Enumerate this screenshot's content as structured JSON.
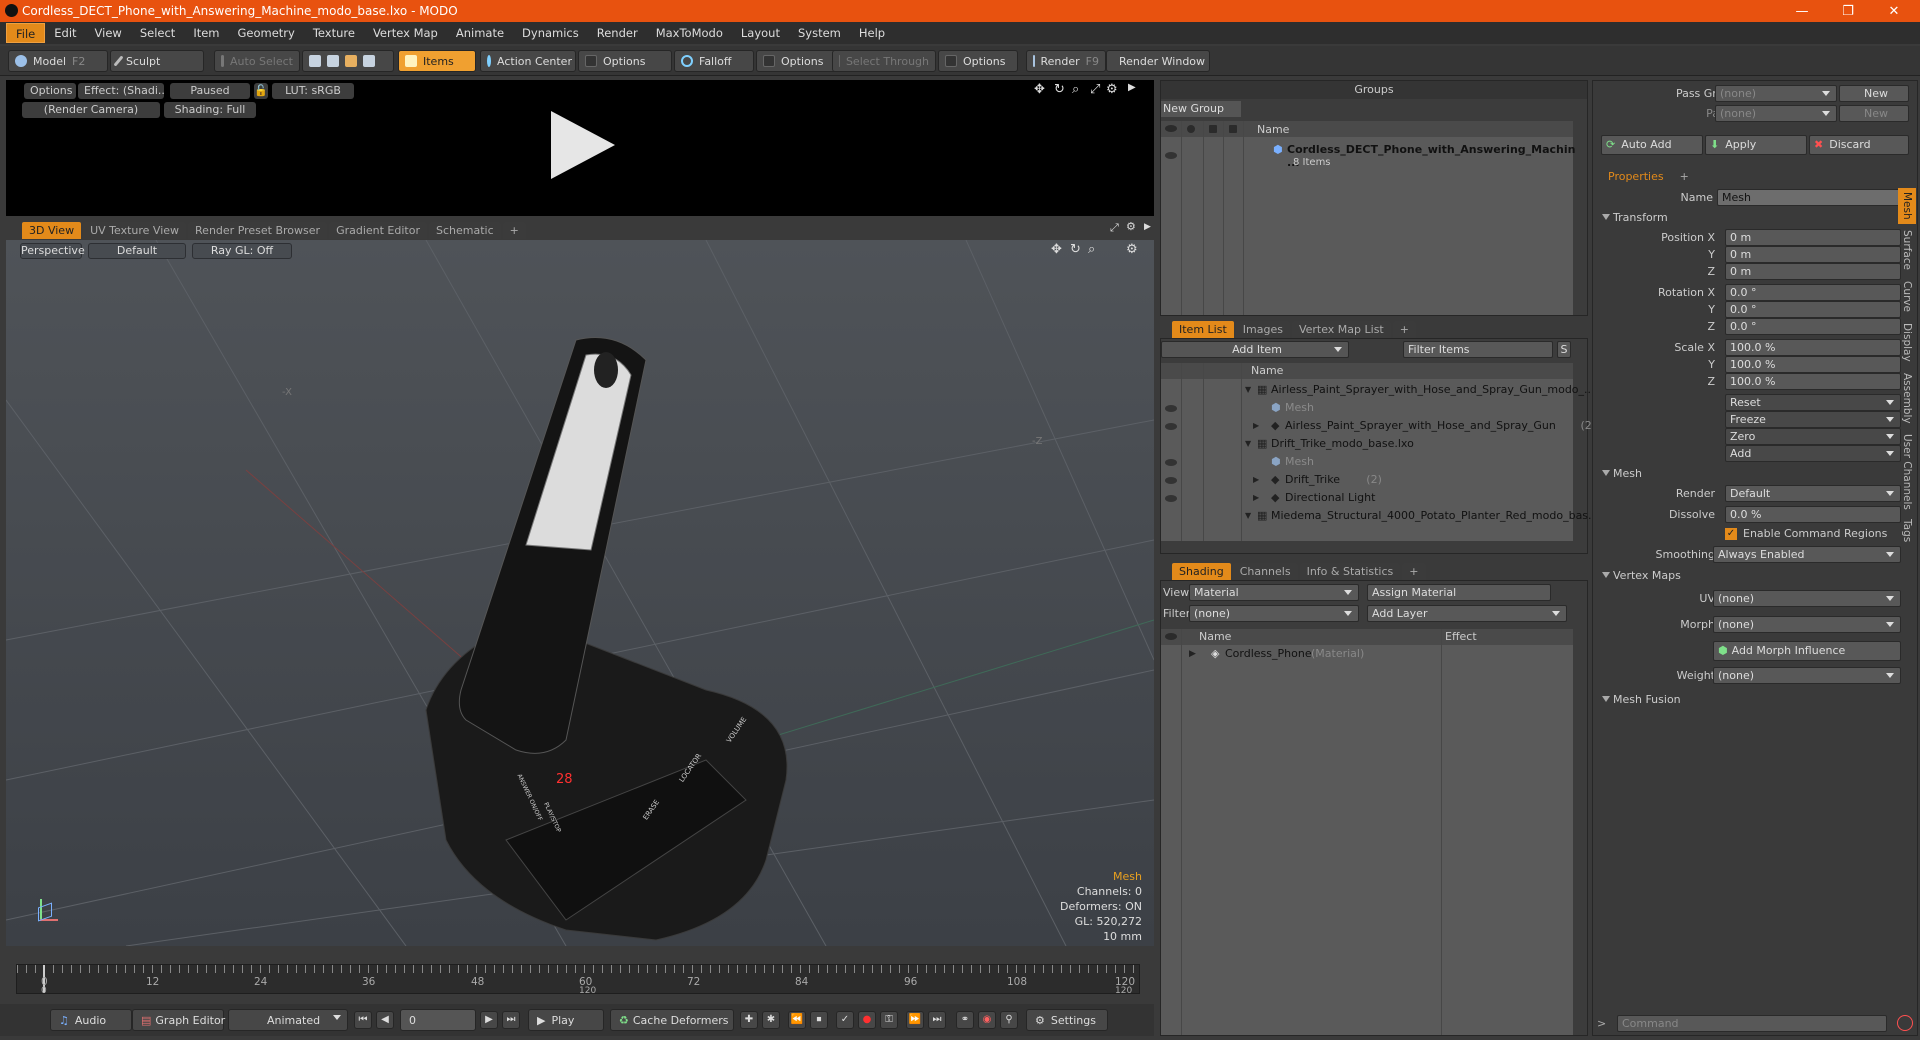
{
  "window": {
    "title": "Cordless_DECT_Phone_with_Answering_Machine_modo_base.lxo - MODO",
    "controls": [
      "—",
      "❐",
      "✕"
    ]
  },
  "menu": [
    "File",
    "Edit",
    "View",
    "Select",
    "Item",
    "Geometry",
    "Texture",
    "Vertex Map",
    "Animate",
    "Dynamics",
    "Render",
    "MaxToModo",
    "Layout",
    "System",
    "Help"
  ],
  "toolbar": {
    "model": "Model",
    "model_key": "F2",
    "sculpt": "Sculpt",
    "auto_select": "Auto Select",
    "items": "Items",
    "action_center": "Action Center",
    "options1": "Options",
    "falloff": "Falloff",
    "options2": "Options",
    "select_through": "Select Through",
    "options3": "Options",
    "render": "Render",
    "render_key": "F9",
    "render_window": "Render Window"
  },
  "render_preview": {
    "options": "Options",
    "effect": "Effect: (Shadi...",
    "paused": "Paused",
    "lut": "LUT: sRGB",
    "camera": "(Render Camera)",
    "shading": "Shading: Full"
  },
  "view_tabs": [
    "3D View",
    "UV Texture View",
    "Render Preset Browser",
    "Gradient Editor",
    "Schematic",
    "+"
  ],
  "viewport": {
    "perspective": "Perspective",
    "default": "Default",
    "raygl": "Ray GL: Off",
    "hud": {
      "type": "Mesh",
      "channels": "Channels: 0",
      "deformers": "Deformers: ON",
      "gl": "GL: 520,272",
      "scale": "10 mm"
    },
    "axis_labels": {
      "x": "-X",
      "z": "-Z"
    },
    "phone_labels": {
      "display": "28",
      "volume": "VOLUME",
      "locator": "LOCATOR",
      "erase": "ERASE",
      "answer": "ANSWER ON/OFF",
      "playstop": "PLAY/STOP"
    }
  },
  "timeline": {
    "ticks": [
      "0",
      "12",
      "24",
      "36",
      "48",
      "60",
      "72",
      "84",
      "96",
      "108",
      "120"
    ],
    "sub_left": "0",
    "sub_mid": "120",
    "sub_right": "120"
  },
  "bottombar": {
    "audio": "Audio",
    "graph_editor": "Graph Editor",
    "animated": "Animated",
    "frame": "0",
    "play": "Play",
    "cache": "Cache Deformers",
    "settings": "Settings"
  },
  "groups": {
    "title": "Groups",
    "new_group": "New Group",
    "col_name": "Name",
    "item_name": "Cordless_DECT_Phone_with_Answering_Machin ...",
    "item_sub": "8 Items"
  },
  "itemlist": {
    "tabs": [
      "Item List",
      "Images",
      "Vertex Map List",
      "+"
    ],
    "add_item": "Add Item",
    "filter": "Filter Items",
    "col_name": "Name",
    "rows": [
      {
        "text": "Airless_Paint_Sprayer_with_Hose_and_Spray_Gun_modo_...",
        "indent": 0,
        "dim": ""
      },
      {
        "text": "Mesh",
        "indent": 1,
        "dim": "mesh"
      },
      {
        "text": "Airless_Paint_Sprayer_with_Hose_and_Spray_Gun",
        "indent": 1,
        "dim": "(2)"
      },
      {
        "text": "Drift_Trike_modo_base.lxo",
        "indent": 0,
        "dim": ""
      },
      {
        "text": "Mesh",
        "indent": 1,
        "dim": "mesh"
      },
      {
        "text": "Drift_Trike",
        "indent": 1,
        "dim": "(2)"
      },
      {
        "text": "Directional Light",
        "indent": 1,
        "dim": ""
      },
      {
        "text": "Miedema_Structural_4000_Potato_Planter_Red_modo_bas...",
        "indent": 0,
        "dim": ""
      }
    ]
  },
  "shading": {
    "tabs": [
      "Shading",
      "Channels",
      "Info & Statistics",
      "+"
    ],
    "view_label": "View",
    "view_value": "Material",
    "assign": "Assign Material",
    "filter_label": "Filter",
    "filter_value": "(none)",
    "add_layer": "Add Layer",
    "col_name": "Name",
    "col_effect": "Effect",
    "row_name": "Cordless_Phone",
    "row_type": "(Material)"
  },
  "properties": {
    "pass_groups": "Pass Groups",
    "passes": "Passes",
    "none": "(none)",
    "new": "New",
    "auto_add": "Auto Add",
    "apply": "Apply",
    "discard": "Discard",
    "tab": "Properties",
    "name_label": "Name",
    "name_value": "Mesh",
    "transform": "Transform",
    "pos_label": "Position X",
    "rot_label": "Rotation X",
    "scale_label": "Scale X",
    "y": "Y",
    "z": "Z",
    "pos": [
      "0 m",
      "0 m",
      "0 m"
    ],
    "rot": [
      "0.0 °",
      "0.0 °",
      "0.0 °"
    ],
    "scale": [
      "100.0 %",
      "100.0 %",
      "100.0 %"
    ],
    "reset": "Reset",
    "freeze": "Freeze",
    "zero": "Zero",
    "add": "Add",
    "mesh": "Mesh",
    "render_label": "Render",
    "render_value": "Default",
    "dissolve_label": "Dissolve",
    "dissolve_value": "0.0 %",
    "enable_cmd": "Enable Command Regions",
    "smoothing_label": "Smoothing",
    "smoothing_value": "Always Enabled",
    "vertex_maps": "Vertex Maps",
    "uv_label": "UV",
    "uv_value": "(none)",
    "morph_label": "Morph",
    "morph_value": "(none)",
    "add_morph": "Add Morph Influence",
    "weight_label": "Weight",
    "weight_value": "(none)",
    "mesh_fusion": "Mesh Fusion",
    "vtabs": [
      "Mesh",
      "Surface",
      "Curve",
      "Display",
      "Assembly",
      "User Channels",
      "Tags"
    ],
    "command": "Command"
  }
}
